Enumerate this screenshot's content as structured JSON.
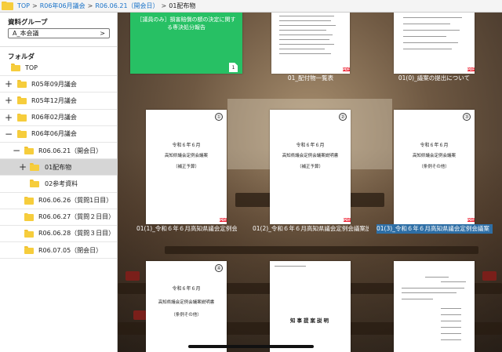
{
  "breadcrumb": {
    "items": [
      "TOP",
      "R06年06月議会",
      "R06.06.21（開会日）"
    ],
    "current": "01配布物",
    "separator": ">"
  },
  "sidebar": {
    "group_title": "資料グループ",
    "group_value": "A_本会議",
    "group_chevron": ">",
    "folder_title": "フォルダ",
    "tree": [
      {
        "label": "TOP",
        "toggle": ""
      },
      {
        "label": "R05年09月議会",
        "toggle": "+"
      },
      {
        "label": "R05年12月議会",
        "toggle": "+"
      },
      {
        "label": "R06年02月議会",
        "toggle": "+"
      },
      {
        "label": "R06年06月議会",
        "toggle": "−"
      },
      {
        "label": "R06.06.21（開会日）",
        "toggle": "−"
      },
      {
        "label": "01配布物",
        "toggle": "+"
      },
      {
        "label": "02参考資料",
        "toggle": ""
      },
      {
        "label": "R06.06.26（質問1日目）",
        "toggle": ""
      },
      {
        "label": "R06.06.27（質問２日目）",
        "toggle": ""
      },
      {
        "label": "R06.06.28（質問３日目）",
        "toggle": ""
      },
      {
        "label": "R06.07.05（閉会日）",
        "toggle": ""
      }
    ]
  },
  "documents": [
    {
      "caption": "",
      "title": "［議員のみ］損害賠償の額の決定に関する専決処分報告",
      "badge": "1"
    },
    {
      "caption": "01_配付物一覧表",
      "pdf": "PDF"
    },
    {
      "caption": "01(0)_議案の提出について",
      "pdf": "PDF"
    },
    {
      "caption": "01(1)_令和６年６月高知県議会定例会議案（補正",
      "number": "①",
      "line1": "令和６年６月",
      "line2": "高知県議会定例会議案",
      "line3": "（補正予算）",
      "pdf": "PDF"
    },
    {
      "caption": "01(2)_令和６年６月高知県議会定例会議案説明書",
      "number": "②",
      "line1": "令和６年６月",
      "line2": "高知県議会定例会議案説明書",
      "line3": "（補正予算）",
      "pdf": "PDF"
    },
    {
      "caption": "01(3)_令和６年６月高知県議会定例会議案（条例",
      "number": "③",
      "line1": "令和６年６月",
      "line2": "高知県議会定例会議案",
      "line3": "（条例その他）",
      "pdf": "PDF"
    },
    {
      "caption": "",
      "number": "④",
      "line1": "令和６年６月",
      "line2": "高知県議会定例会議案説明書",
      "line3": "（条例その他）"
    },
    {
      "caption": "",
      "line1": "知事提案説明"
    },
    {
      "caption": ""
    }
  ]
}
